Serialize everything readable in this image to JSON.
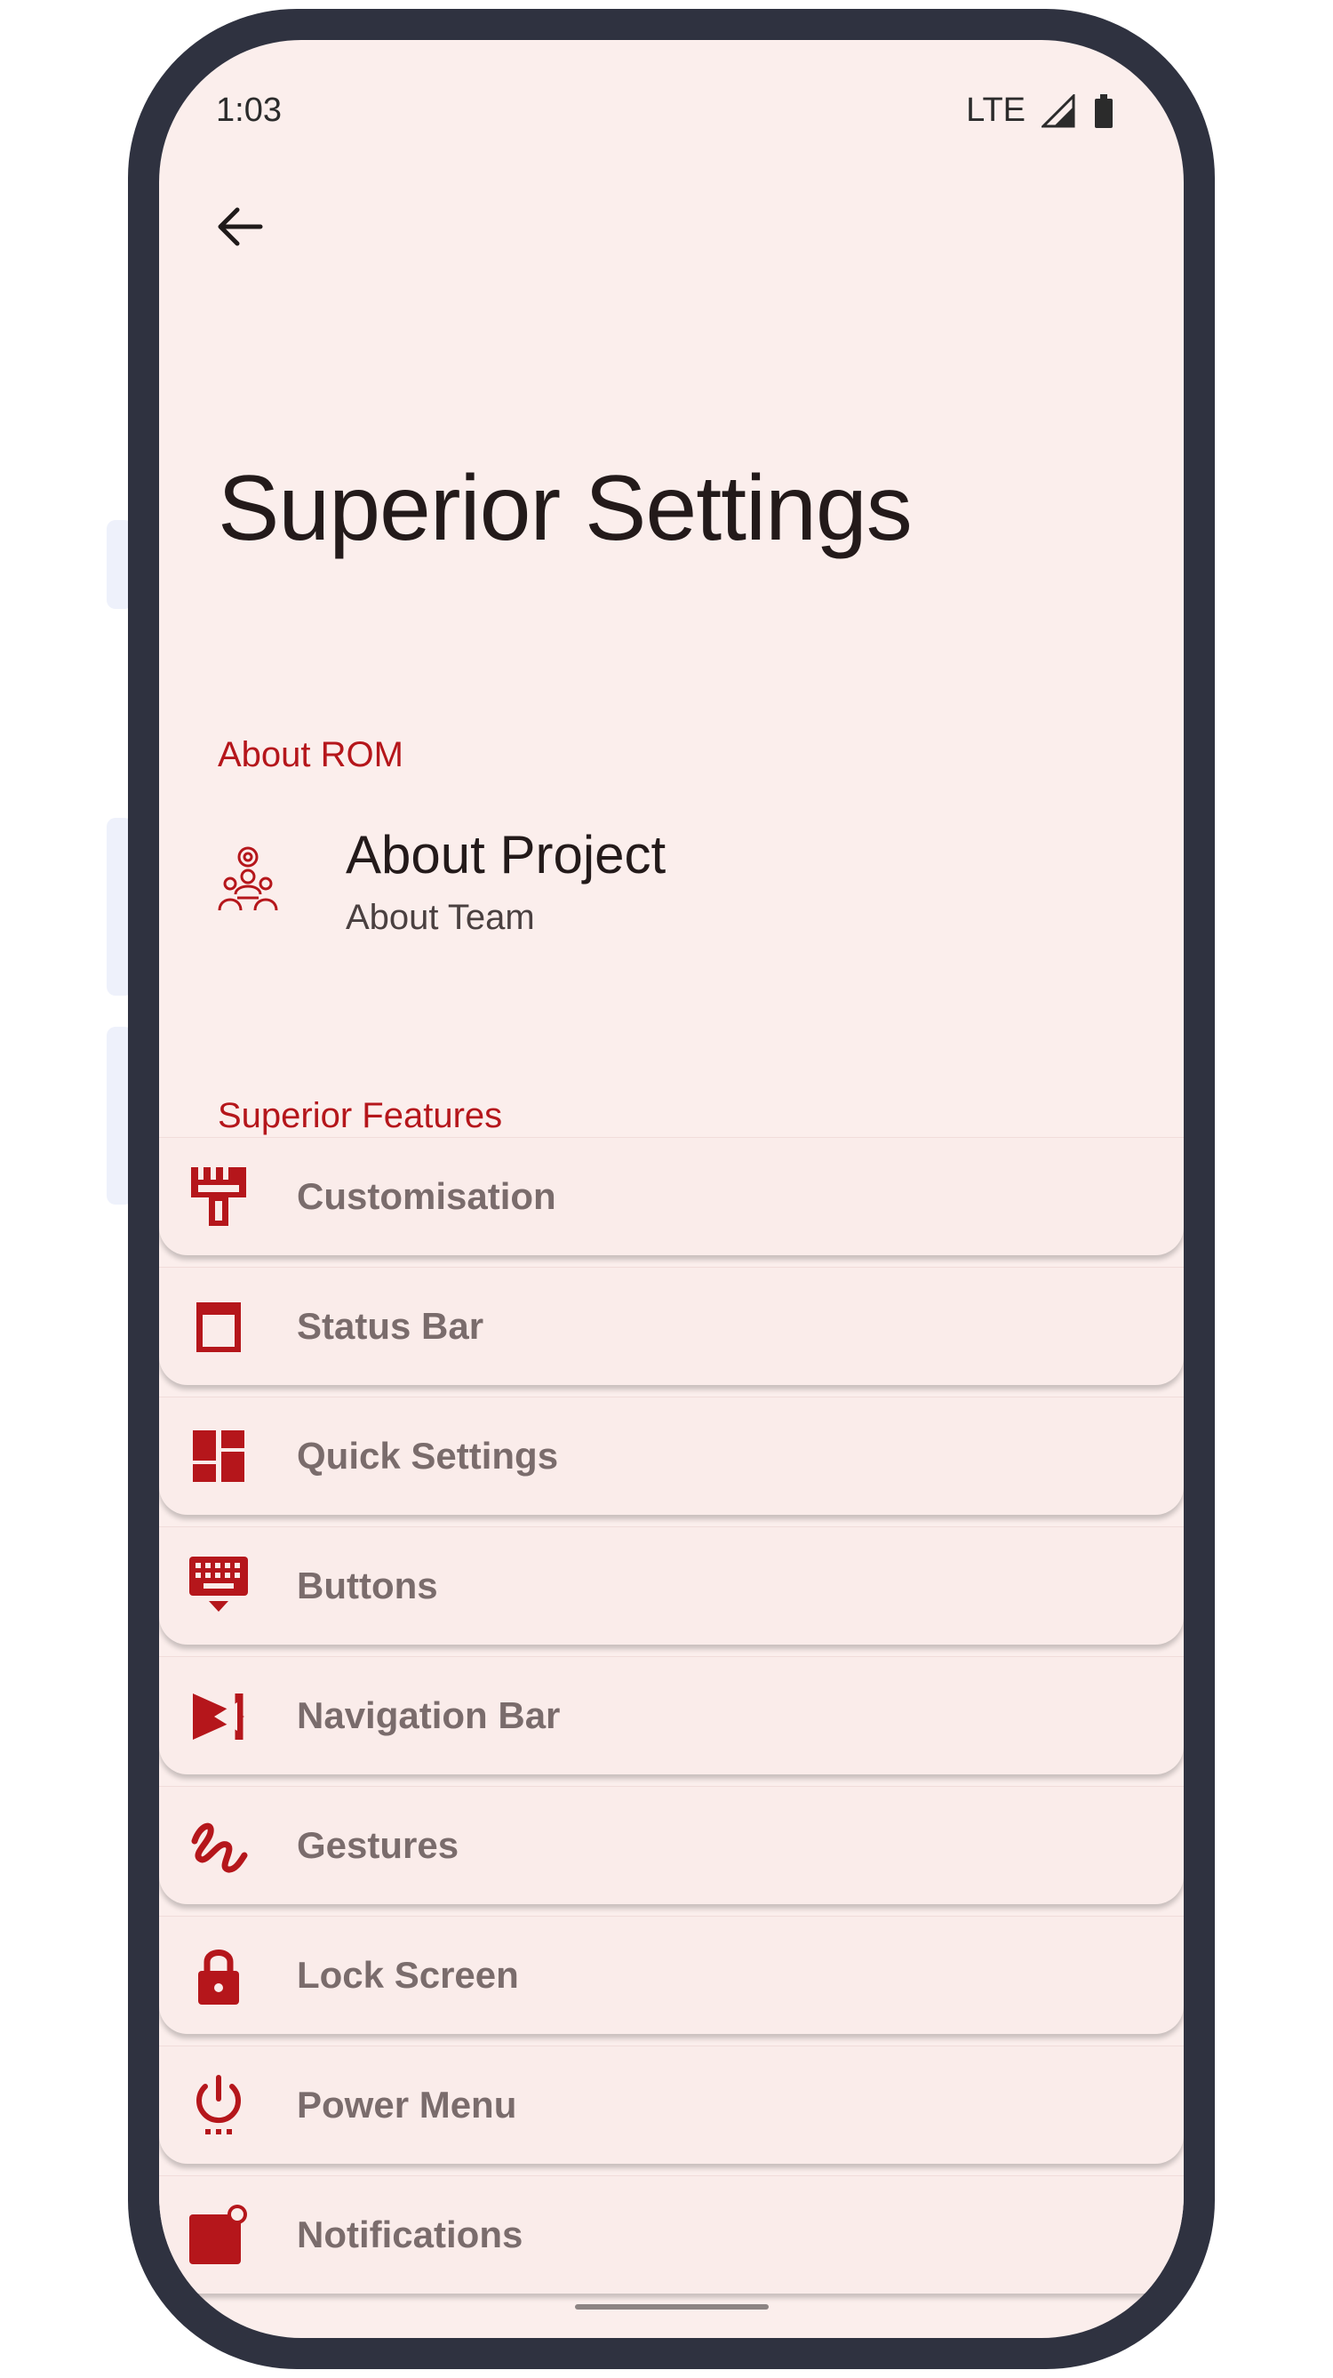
{
  "status_bar": {
    "time": "1:03",
    "network": "LTE"
  },
  "page": {
    "title": "Superior Settings"
  },
  "sections": {
    "about_rom": "About ROM",
    "superior_features": "Superior Features"
  },
  "about_item": {
    "title": "About Project",
    "subtitle": "About Team",
    "icon": "team-icon"
  },
  "features": [
    {
      "label": "Customisation",
      "icon": "paint-brush-icon"
    },
    {
      "label": "Status Bar",
      "icon": "status-bar-icon"
    },
    {
      "label": "Quick Settings",
      "icon": "dashboard-icon"
    },
    {
      "label": "Buttons",
      "icon": "keyboard-icon"
    },
    {
      "label": "Navigation Bar",
      "icon": "navigation-icon"
    },
    {
      "label": "Gestures",
      "icon": "gesture-icon"
    },
    {
      "label": "Lock Screen",
      "icon": "lock-icon"
    },
    {
      "label": "Power Menu",
      "icon": "power-icon"
    },
    {
      "label": "Notifications",
      "icon": "notification-icon"
    }
  ],
  "colors": {
    "accent": "#b5161b",
    "background": "#fbeeec",
    "frame": "#2f3240",
    "title_text": "#231a1a",
    "feature_text": "#7a6c6c"
  }
}
